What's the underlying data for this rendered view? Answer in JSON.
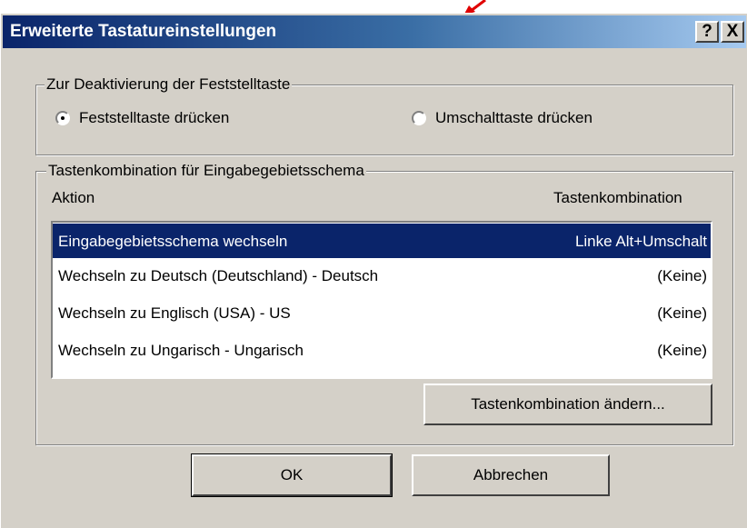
{
  "window": {
    "title": "Erweiterte Tastatureinstellungen",
    "help_glyph": "?",
    "close_glyph": "X"
  },
  "capslock_group": {
    "label": "Zur Deaktivierung der Feststelltaste",
    "options": [
      {
        "label": "Feststelltaste drücken",
        "selected": true
      },
      {
        "label": "Umschalttaste drücken",
        "selected": false
      }
    ]
  },
  "hotkey_group": {
    "label": "Tastenkombination für Eingabegebietsschema",
    "columns": {
      "action": "Aktion",
      "combination": "Tastenkombination"
    },
    "rows": [
      {
        "action": "Eingabegebietsschema wechseln",
        "combination": "Linke Alt+Umschalt",
        "selected": true
      },
      {
        "action": "Wechseln zu Deutsch (Deutschland) - Deutsch",
        "combination": "(Keine)",
        "selected": false
      },
      {
        "action": "Wechseln zu Englisch (USA) - US",
        "combination": "(Keine)",
        "selected": false
      },
      {
        "action": "Wechseln zu Ungarisch - Ungarisch",
        "combination": "(Keine)",
        "selected": false
      }
    ],
    "change_button": "Tastenkombination ändern..."
  },
  "footer": {
    "ok": "OK",
    "cancel": "Abbrechen"
  },
  "colors": {
    "title_start": "#0a246a",
    "title_end": "#a6caf0",
    "face": "#d4d0c8",
    "selection": "#0a246a",
    "annotation": "#e00000"
  }
}
